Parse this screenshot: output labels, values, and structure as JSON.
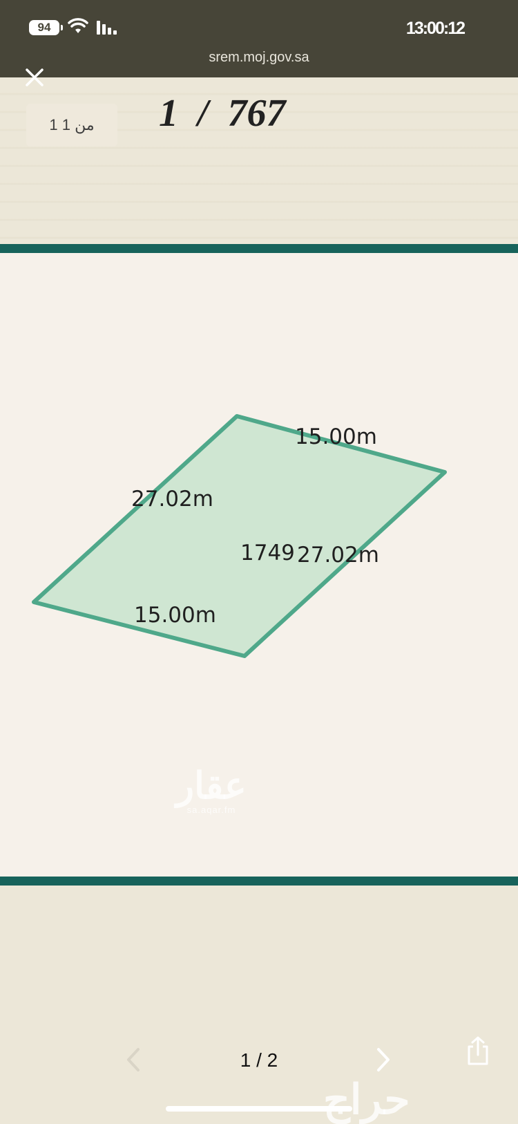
{
  "status_bar": {
    "battery_level": "94",
    "time": "13:00:12",
    "icons": [
      "battery-icon",
      "wifi-icon",
      "cellular-signal-icon"
    ]
  },
  "browser": {
    "url": "srem.moj.gov.sa",
    "close_icon": "close-icon"
  },
  "document": {
    "page_chip": "1 من 1",
    "page_number": "1  /  767"
  },
  "plot": {
    "parcel_id": "1749",
    "edge_labels": {
      "top": "15.00m",
      "left": "27.02m",
      "right": "27.02m",
      "bottom": "15.00m"
    },
    "fill_color": "#cfe6d2",
    "stroke_color": "#4fa88a",
    "band_color": "#17635b"
  },
  "watermarks": {
    "aqar": "عقار",
    "aqar_latin": "sa.aqar.fm",
    "haraj": "حراج"
  },
  "pager": {
    "indicator": "1 / 2",
    "prev_icon": "chevron-left-icon",
    "next_icon": "chevron-right-icon",
    "share_icon": "share-icon"
  }
}
